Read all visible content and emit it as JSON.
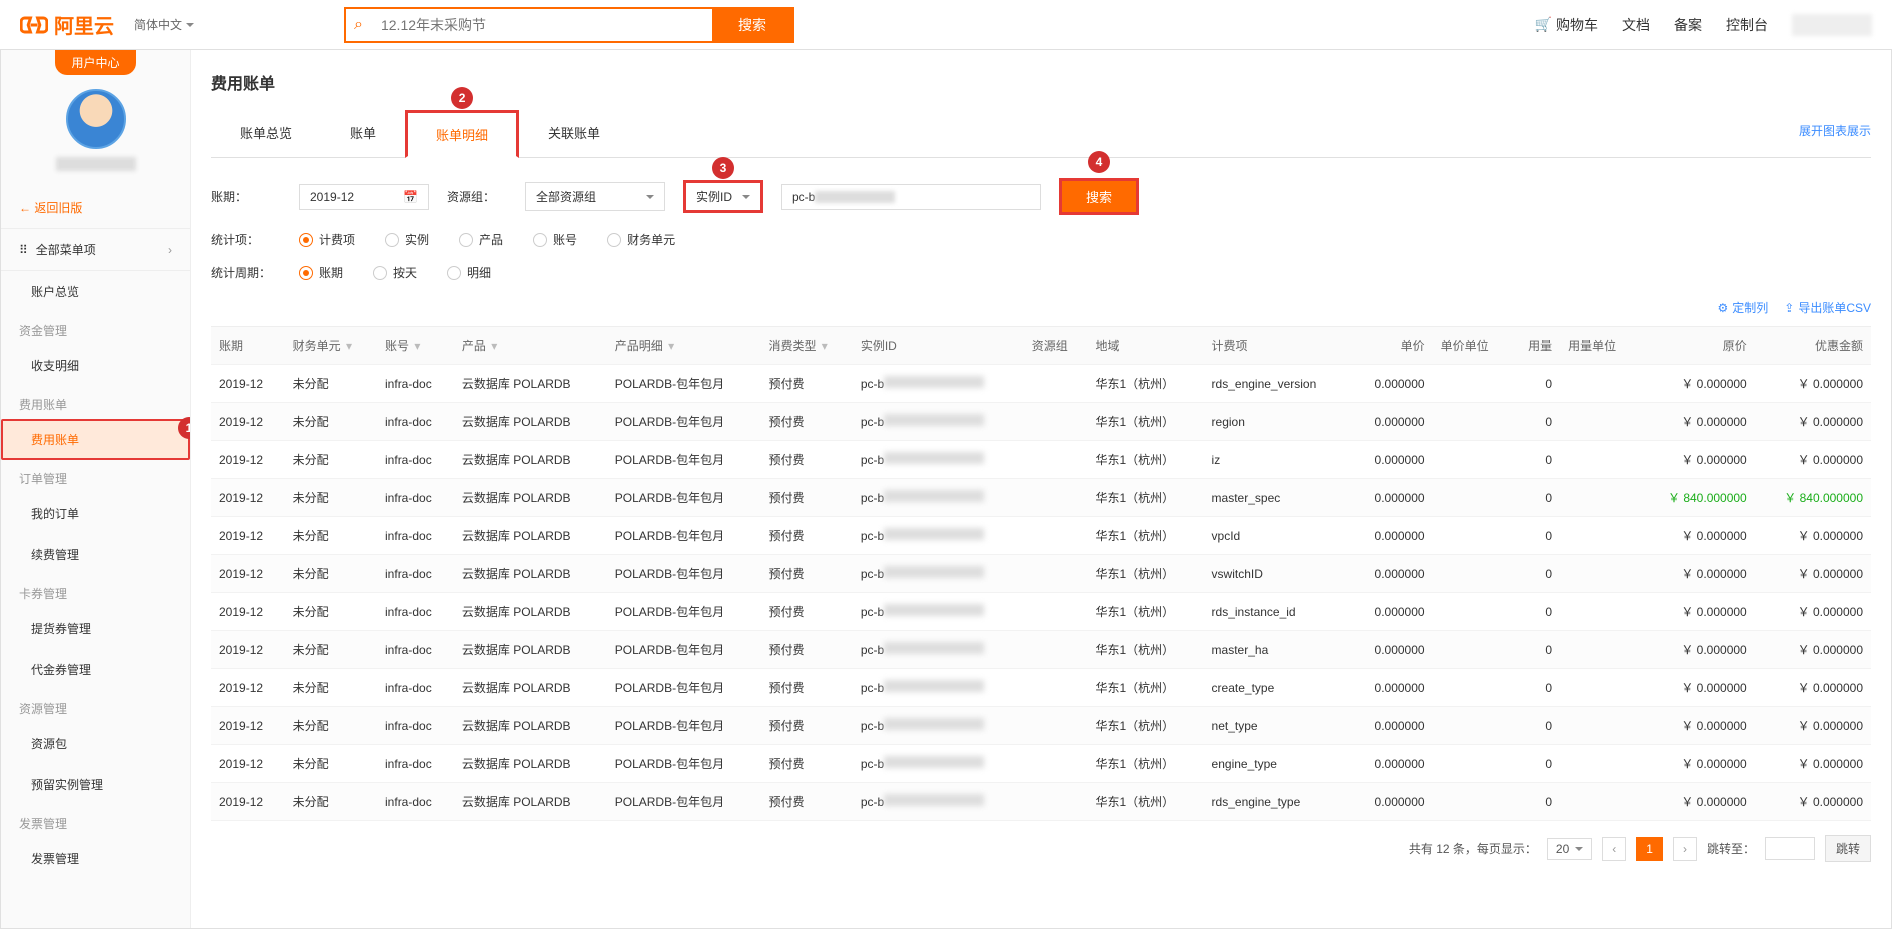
{
  "header": {
    "brand": "阿里云",
    "lang": "简体中文",
    "search_placeholder": "12.12年末采购节",
    "search_btn": "搜索",
    "links": {
      "cart": "购物车",
      "docs": "文档",
      "beian": "备案",
      "console": "控制台"
    }
  },
  "sidebar": {
    "user_center": "用户中心",
    "back_old": "← 返回旧版",
    "all_menu": "全部菜单项",
    "account_overview": "账户总览",
    "groups": [
      {
        "title": "资金管理",
        "items": [
          "收支明细"
        ]
      },
      {
        "title": "费用账单",
        "items": [
          "费用账单"
        ],
        "active_index": 0
      },
      {
        "title": "订单管理",
        "items": [
          "我的订单",
          "续费管理"
        ]
      },
      {
        "title": "卡券管理",
        "items": [
          "提货券管理",
          "代金券管理"
        ]
      },
      {
        "title": "资源管理",
        "items": [
          "资源包",
          "预留实例管理"
        ]
      },
      {
        "title": "发票管理",
        "items": [
          "发票管理"
        ]
      }
    ]
  },
  "page": {
    "title": "费用账单",
    "tabs": [
      "账单总览",
      "账单",
      "账单明细",
      "关联账单"
    ],
    "active_tab": 2,
    "expand_chart": "展开图表展示",
    "badges": {
      "b1": "1",
      "b2": "2",
      "b3": "3",
      "b4": "4"
    }
  },
  "filters": {
    "period_label": "账期：",
    "period_value": "2019-12",
    "resgroup_label": "资源组：",
    "resgroup_value": "全部资源组",
    "id_type": "实例ID",
    "id_prefix": "pc-b",
    "search_btn": "搜索",
    "stat_item_label": "统计项：",
    "stat_items": [
      "计费项",
      "实例",
      "产品",
      "账号",
      "财务单元"
    ],
    "stat_item_active": 0,
    "stat_period_label": "统计周期：",
    "stat_periods": [
      "账期",
      "按天",
      "明细"
    ],
    "stat_period_active": 0
  },
  "actions": {
    "custom_cols": "定制列",
    "export_csv": "导出账单CSV"
  },
  "table": {
    "headers": [
      "账期",
      "财务单元",
      "账号",
      "产品",
      "产品明细",
      "消费类型",
      "实例ID",
      "资源组",
      "地域",
      "计费项",
      "单价",
      "单价单位",
      "用量",
      "用量单位",
      "原价",
      "优惠金额"
    ],
    "filterable": [
      1,
      2,
      3,
      4,
      5
    ],
    "rows": [
      {
        "period": "2019-12",
        "fin": "未分配",
        "acct": "infra-doc",
        "prod": "云数据库 POLARDB",
        "detail": "POLARDB-包年包月",
        "ctype": "预付费",
        "iid": "pc-b",
        "region": "华东1（杭州）",
        "item": "rds_engine_version",
        "price": "0.000000",
        "punit": "",
        "usage": "0",
        "uunit": "",
        "orig": "￥ 0.000000",
        "disc": "￥ 0.000000",
        "green": false
      },
      {
        "period": "2019-12",
        "fin": "未分配",
        "acct": "infra-doc",
        "prod": "云数据库 POLARDB",
        "detail": "POLARDB-包年包月",
        "ctype": "预付费",
        "iid": "pc-b",
        "region": "华东1（杭州）",
        "item": "region",
        "price": "0.000000",
        "punit": "",
        "usage": "0",
        "uunit": "",
        "orig": "￥ 0.000000",
        "disc": "￥ 0.000000",
        "green": false
      },
      {
        "period": "2019-12",
        "fin": "未分配",
        "acct": "infra-doc",
        "prod": "云数据库 POLARDB",
        "detail": "POLARDB-包年包月",
        "ctype": "预付费",
        "iid": "pc-b",
        "region": "华东1（杭州）",
        "item": "iz",
        "price": "0.000000",
        "punit": "",
        "usage": "0",
        "uunit": "",
        "orig": "￥ 0.000000",
        "disc": "￥ 0.000000",
        "green": false
      },
      {
        "period": "2019-12",
        "fin": "未分配",
        "acct": "infra-doc",
        "prod": "云数据库 POLARDB",
        "detail": "POLARDB-包年包月",
        "ctype": "预付费",
        "iid": "pc-b",
        "region": "华东1（杭州）",
        "item": "master_spec",
        "price": "0.000000",
        "punit": "",
        "usage": "0",
        "uunit": "",
        "orig": "￥ 840.000000",
        "disc": "￥ 840.000000",
        "green": true
      },
      {
        "period": "2019-12",
        "fin": "未分配",
        "acct": "infra-doc",
        "prod": "云数据库 POLARDB",
        "detail": "POLARDB-包年包月",
        "ctype": "预付费",
        "iid": "pc-b",
        "region": "华东1（杭州）",
        "item": "vpcId",
        "price": "0.000000",
        "punit": "",
        "usage": "0",
        "uunit": "",
        "orig": "￥ 0.000000",
        "disc": "￥ 0.000000",
        "green": false
      },
      {
        "period": "2019-12",
        "fin": "未分配",
        "acct": "infra-doc",
        "prod": "云数据库 POLARDB",
        "detail": "POLARDB-包年包月",
        "ctype": "预付费",
        "iid": "pc-b",
        "region": "华东1（杭州）",
        "item": "vswitchID",
        "price": "0.000000",
        "punit": "",
        "usage": "0",
        "uunit": "",
        "orig": "￥ 0.000000",
        "disc": "￥ 0.000000",
        "green": false
      },
      {
        "period": "2019-12",
        "fin": "未分配",
        "acct": "infra-doc",
        "prod": "云数据库 POLARDB",
        "detail": "POLARDB-包年包月",
        "ctype": "预付费",
        "iid": "pc-b",
        "region": "华东1（杭州）",
        "item": "rds_instance_id",
        "price": "0.000000",
        "punit": "",
        "usage": "0",
        "uunit": "",
        "orig": "￥ 0.000000",
        "disc": "￥ 0.000000",
        "green": false
      },
      {
        "period": "2019-12",
        "fin": "未分配",
        "acct": "infra-doc",
        "prod": "云数据库 POLARDB",
        "detail": "POLARDB-包年包月",
        "ctype": "预付费",
        "iid": "pc-b",
        "region": "华东1（杭州）",
        "item": "master_ha",
        "price": "0.000000",
        "punit": "",
        "usage": "0",
        "uunit": "",
        "orig": "￥ 0.000000",
        "disc": "￥ 0.000000",
        "green": false
      },
      {
        "period": "2019-12",
        "fin": "未分配",
        "acct": "infra-doc",
        "prod": "云数据库 POLARDB",
        "detail": "POLARDB-包年包月",
        "ctype": "预付费",
        "iid": "pc-b",
        "region": "华东1（杭州）",
        "item": "create_type",
        "price": "0.000000",
        "punit": "",
        "usage": "0",
        "uunit": "",
        "orig": "￥ 0.000000",
        "disc": "￥ 0.000000",
        "green": false
      },
      {
        "period": "2019-12",
        "fin": "未分配",
        "acct": "infra-doc",
        "prod": "云数据库 POLARDB",
        "detail": "POLARDB-包年包月",
        "ctype": "预付费",
        "iid": "pc-b",
        "region": "华东1（杭州）",
        "item": "net_type",
        "price": "0.000000",
        "punit": "",
        "usage": "0",
        "uunit": "",
        "orig": "￥ 0.000000",
        "disc": "￥ 0.000000",
        "green": false
      },
      {
        "period": "2019-12",
        "fin": "未分配",
        "acct": "infra-doc",
        "prod": "云数据库 POLARDB",
        "detail": "POLARDB-包年包月",
        "ctype": "预付费",
        "iid": "pc-b",
        "region": "华东1（杭州）",
        "item": "engine_type",
        "price": "0.000000",
        "punit": "",
        "usage": "0",
        "uunit": "",
        "orig": "￥ 0.000000",
        "disc": "￥ 0.000000",
        "green": false
      },
      {
        "period": "2019-12",
        "fin": "未分配",
        "acct": "infra-doc",
        "prod": "云数据库 POLARDB",
        "detail": "POLARDB-包年包月",
        "ctype": "预付费",
        "iid": "pc-b",
        "region": "华东1（杭州）",
        "item": "rds_engine_type",
        "price": "0.000000",
        "punit": "",
        "usage": "0",
        "uunit": "",
        "orig": "￥ 0.000000",
        "disc": "￥ 0.000000",
        "green": false
      }
    ]
  },
  "pager": {
    "total_text_prefix": "共有 ",
    "total": "12",
    "total_text_mid": " 条，每页显示：",
    "page_size": "20",
    "current": "1",
    "jump_label": "跳转至：",
    "jump_btn": "跳转"
  }
}
